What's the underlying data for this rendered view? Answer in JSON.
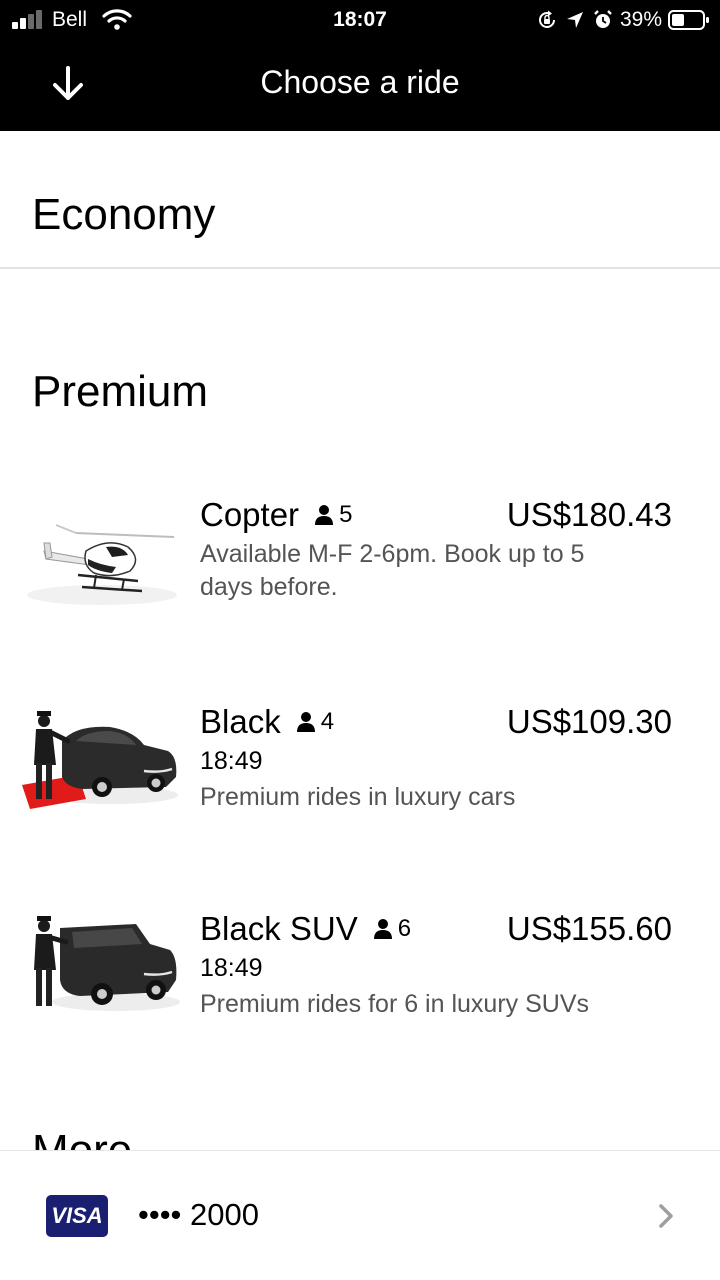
{
  "status_bar": {
    "carrier": "Bell",
    "time": "18:07",
    "battery_pct": "39%",
    "icons": [
      "signal-icon",
      "wifi-icon",
      "rotation-lock-icon",
      "location-arrow-icon",
      "alarm-icon",
      "battery-icon"
    ]
  },
  "header": {
    "title": "Choose a ride",
    "back_icon": "arrow-down-icon"
  },
  "sections": {
    "economy": "Economy",
    "premium": "Premium",
    "more": "More"
  },
  "rides": [
    {
      "name": "Copter",
      "capacity": "5",
      "price": "US$180.43",
      "line1": "Available M-F 2-6pm. Book up to 5",
      "line2": "days before."
    },
    {
      "name": "Black",
      "capacity": "4",
      "price": "US$109.30",
      "time": "18:49",
      "desc": "Premium rides in luxury cars"
    },
    {
      "name": "Black SUV",
      "capacity": "6",
      "price": "US$155.60",
      "time": "18:49",
      "desc": "Premium rides for 6 in luxury SUVs"
    }
  ],
  "payment": {
    "brand": "VISA",
    "card": "•••• 2000",
    "brand_color": "#1a1f71"
  }
}
